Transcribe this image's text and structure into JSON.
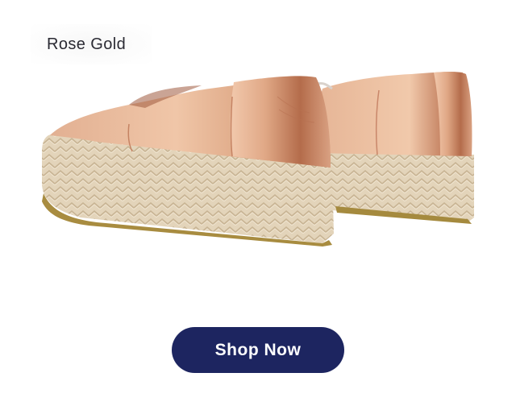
{
  "product": {
    "color_name": "Rose Gold",
    "image_alt": "rose-gold-espadrille-platform-shoes"
  },
  "cta": {
    "label": "Shop Now"
  },
  "colors": {
    "button_bg": "#1d2560",
    "button_text": "#ffffff",
    "label_text": "#2a2a33"
  }
}
